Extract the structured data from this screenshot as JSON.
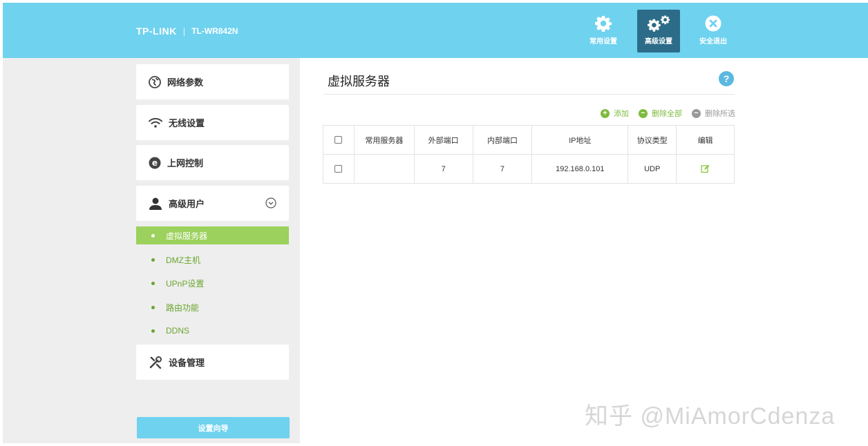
{
  "header": {
    "logo": "TP-LINK",
    "separator": "|",
    "model": "TL-WR842N",
    "nav": [
      {
        "label": "常用设置",
        "icon": "gear-icon",
        "active": false
      },
      {
        "label": "高级设置",
        "icon": "gears-icon",
        "active": true
      },
      {
        "label": "安全退出",
        "icon": "close-icon",
        "active": false
      }
    ]
  },
  "sidebar": {
    "menu": [
      {
        "label": "网络参数",
        "icon": "globe-icon"
      },
      {
        "label": "无线设置",
        "icon": "wifi-icon"
      },
      {
        "label": "上网控制",
        "icon": "ie-icon"
      },
      {
        "label": "高级用户",
        "icon": "user-icon",
        "expanded": true
      },
      {
        "label": "设备管理",
        "icon": "tools-icon"
      }
    ],
    "submenu": [
      {
        "label": "虚拟服务器",
        "active": true
      },
      {
        "label": "DMZ主机",
        "active": false
      },
      {
        "label": "UPnP设置",
        "active": false
      },
      {
        "label": "路由功能",
        "active": false
      },
      {
        "label": "DDNS",
        "active": false
      }
    ],
    "wizard_label": "设置向导"
  },
  "main": {
    "title": "虚拟服务器",
    "help_label": "?",
    "actions": {
      "add": "添加",
      "delete_all": "删除全部",
      "delete_selected": "删除所选"
    },
    "table": {
      "columns": [
        "常用服务器",
        "外部端口",
        "内部端口",
        "IP地址",
        "协议类型",
        "编辑"
      ],
      "rows": [
        {
          "service": "",
          "external_port": "7",
          "internal_port": "7",
          "ip": "192.168.0.101",
          "protocol": "UDP"
        }
      ]
    }
  },
  "watermark": "知乎 @MiAmorCdenza",
  "colors": {
    "header": "#6fd2ef",
    "active_nav": "#2c6c88",
    "accent_green": "#9bd15c",
    "link_green": "#6aa52c",
    "sidebar_bg": "#eeeeee"
  }
}
